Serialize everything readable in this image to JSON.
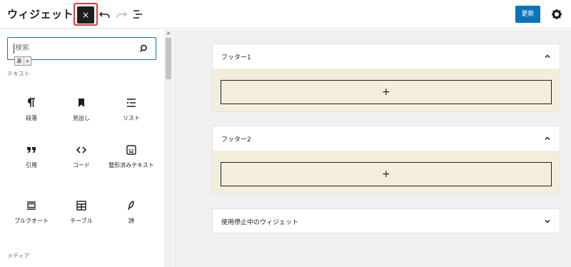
{
  "header": {
    "title": "ウィジェット",
    "close_label": "×",
    "undo_icon": "undo-icon",
    "redo_icon": "redo-icon",
    "list_view_icon": "list-view-icon",
    "update_label": "更新",
    "settings_icon": "gear-icon",
    "accent": "#0a74b9",
    "highlight": "#e23b3b"
  },
  "sidebar": {
    "search_placeholder": "検索",
    "ime_badge": [
      "あ",
      "»"
    ],
    "category_text": "テキスト",
    "category_media": "メディア",
    "blocks": [
      {
        "label": "段落",
        "icon": "paragraph-icon"
      },
      {
        "label": "見出し",
        "icon": "heading-bookmark-icon"
      },
      {
        "label": "リスト",
        "icon": "list-icon"
      },
      {
        "label": "引用",
        "icon": "quote-icon"
      },
      {
        "label": "コード",
        "icon": "code-icon"
      },
      {
        "label": "整形済みテキスト",
        "icon": "preformatted-icon"
      },
      {
        "label": "プルクオート",
        "icon": "pullquote-icon"
      },
      {
        "label": "テーブル",
        "icon": "table-icon"
      },
      {
        "label": "詩",
        "icon": "verse-feather-icon"
      }
    ]
  },
  "main": {
    "areas": [
      {
        "title": "フッター1",
        "expanded": true,
        "appender": "+"
      },
      {
        "title": "フッター2",
        "expanded": true,
        "appender": "+"
      },
      {
        "title": "使用停止中のウィジェット",
        "expanded": false
      }
    ],
    "area_bg": "#f3eedc"
  }
}
